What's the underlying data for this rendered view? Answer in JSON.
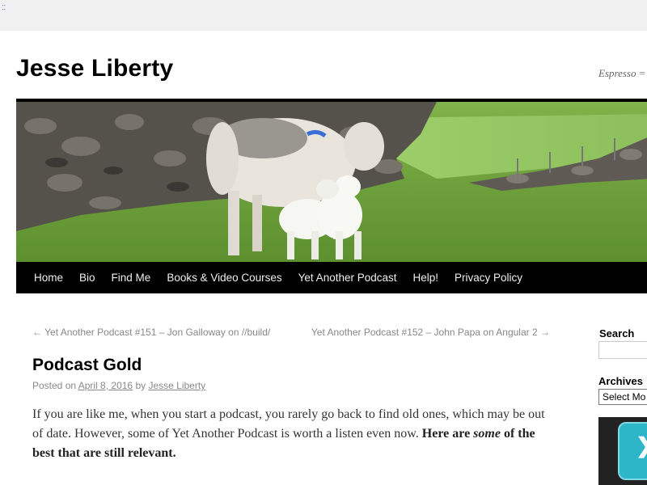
{
  "site": {
    "title": "Jesse Liberty",
    "tagline": "Espresso ="
  },
  "nav": {
    "items": [
      "Home",
      "Bio",
      "Find Me",
      "Books & Video Courses",
      "Yet Another Podcast",
      "Help!",
      "Privacy Policy"
    ]
  },
  "post_nav": {
    "previous": "← Yet Another Podcast #151 – Jon Galloway on //build/",
    "next": "Yet Another Podcast #152 – John Papa on Angular 2 →"
  },
  "post": {
    "title": "Podcast Gold",
    "meta_posted_on": "Posted on",
    "meta_date": "April 8, 2016",
    "meta_by": "by",
    "meta_author": "Jesse Liberty",
    "body_plain": "If you are like me, when you start a podcast, you rarely go back to find old ones, which may be out of date.  However, some of Yet Another Podcast is worth a listen even now.",
    "body_bold_1": "Here are",
    "body_bold_em": "some",
    "body_bold_2": "of the best that are still relevant."
  },
  "sidebar": {
    "search_title": "Search",
    "archives_title": "Archives",
    "archives_select": "Select Mo"
  },
  "icons": {
    "widget": "chevron-right-icon"
  },
  "colors": {
    "nav_bg": "#000000",
    "widget_accent": "#2db5c8"
  }
}
